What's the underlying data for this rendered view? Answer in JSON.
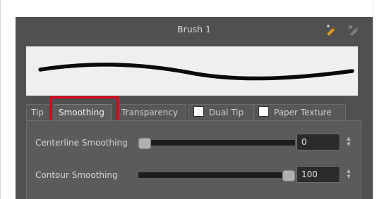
{
  "window": {
    "title": "Brush 1"
  },
  "header_icons": [
    "new-brush-icon",
    "delete-brush-icon"
  ],
  "tabs": [
    {
      "label": "Tip",
      "active": false
    },
    {
      "label": "Smoothing",
      "active": true
    },
    {
      "label": "Transparency",
      "active": false
    },
    {
      "label": "Dual Tip",
      "checkbox": true,
      "checked": false
    },
    {
      "label": "Paper Texture",
      "checkbox": true,
      "checked": false
    }
  ],
  "settings": {
    "centerline": {
      "label": "Centerline Smoothing",
      "value": "0",
      "level": 0
    },
    "contour": {
      "label": "Contour Smoothing",
      "value": "100",
      "level": 1
    }
  },
  "colors": {
    "panel": "#505050",
    "highlight": "#e3001b"
  }
}
